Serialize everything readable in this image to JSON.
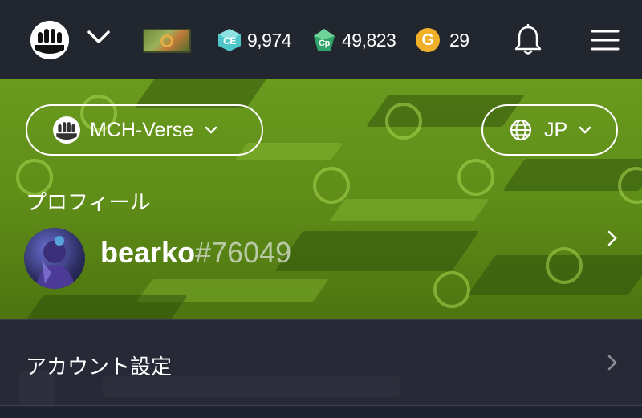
{
  "topbar": {
    "logo_icon": "paw-logo-icon",
    "dropdown_icon": "chevron-down-icon",
    "nft_icon": "nft-thumbnail-icon",
    "ce": {
      "icon": "ce-coin-icon",
      "label": "CE",
      "value": "9,974"
    },
    "cp": {
      "icon": "cp-crystal-icon",
      "label": "Cp",
      "value": "49,823"
    },
    "gold": {
      "icon": "gold-coin-icon",
      "label": "G",
      "value": "29"
    },
    "bell_icon": "bell-icon",
    "menu_icon": "hamburger-menu-icon"
  },
  "banner": {
    "verse_selector": {
      "label": "MCH-Verse",
      "icon": "paw-logo-icon"
    },
    "language_selector": {
      "label": "JP",
      "icon": "globe-icon"
    },
    "section_title": "プロフィール",
    "user": {
      "name": "bearko",
      "tag": "#76049"
    }
  },
  "account_settings": {
    "label": "アカウント設定"
  },
  "colors": {
    "topbar": "#22262f",
    "banner_green": "#5f8d18",
    "account_bg": "#272a36",
    "gold": "#f0b028",
    "teal": "#4fc6c9"
  }
}
